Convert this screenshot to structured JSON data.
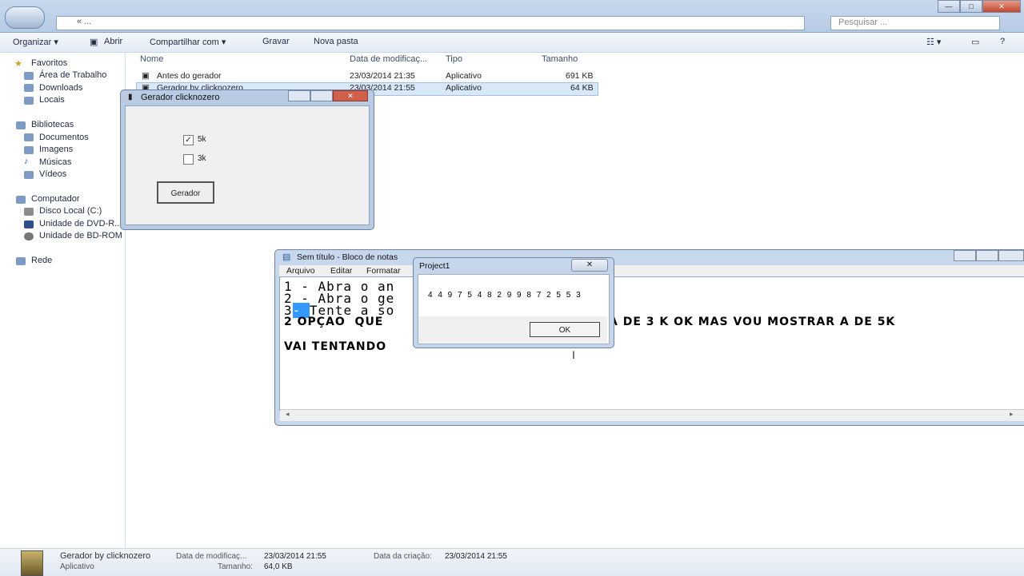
{
  "explorer": {
    "address_text": "« ...",
    "search_placeholder": "Pesquisar ...",
    "toolbar": {
      "organize": "Organizar ▾",
      "open": "Abrir",
      "share": "Compartilhar com ▾",
      "burn": "Gravar",
      "new_folder": "Nova pasta"
    },
    "nav": {
      "favorites": "Favoritos",
      "desktop": "Área de Trabalho",
      "downloads": "Downloads",
      "locals": "Locais",
      "libraries": "Bibliotecas",
      "documents": "Documentos",
      "images": "Imagens",
      "music": "Músicas",
      "videos": "Vídeos",
      "computer": "Computador",
      "disk_c": "Disco Local (C:)",
      "dvd": "Unidade de DVD-R...",
      "bd": "Unidade de BD-ROM...",
      "network": "Rede"
    },
    "columns": {
      "name": "Nome",
      "date": "Data de modificaç...",
      "type": "Tipo",
      "size": "Tamanho"
    },
    "files": [
      {
        "name": "Antes do gerador",
        "date": "23/03/2014 21:35",
        "type": "Aplicativo",
        "size": "691 KB"
      },
      {
        "name": "Gerador by clicknozero",
        "date": "23/03/2014 21:55",
        "type": "Aplicativo",
        "size": "64 KB"
      }
    ],
    "details": {
      "name": "Gerador by clicknozero",
      "kind": "Aplicativo",
      "modified_label": "Data de modificaç...",
      "modified": "23/03/2014 21:55",
      "created_label": "Data da criação:",
      "created": "23/03/2014 21:55",
      "size_label": "Tamanho:",
      "size": "64,0 KB"
    }
  },
  "gerador": {
    "title": "Gerador clicknozero",
    "opt1": "5k",
    "opt1_checked": "✓",
    "opt2": "3k",
    "button": "Gerador"
  },
  "notepad": {
    "title": "Sem título - Bloco de notas",
    "menu": {
      "file": "Arquivo",
      "edit": "Editar",
      "format": "Formatar"
    },
    "line1": "1 - Abra o an",
    "line2": "2 - Abra o ge",
    "line3_num": "3",
    "line3_sel": "- ",
    "line3_rest": "Tente a so",
    "line4_left": "2 OPÇAO  QUE",
    "line4_right": "A DE 3 K OK MAS VOU MOSTRAR A DE 5K",
    "line6": "VAI TENTANDO"
  },
  "messagebox": {
    "title": "Project1",
    "close": "✕",
    "text": "4 4 9 7 5 4 8 2 9 9 8 7 2 5 5 3",
    "ok": "OK"
  }
}
